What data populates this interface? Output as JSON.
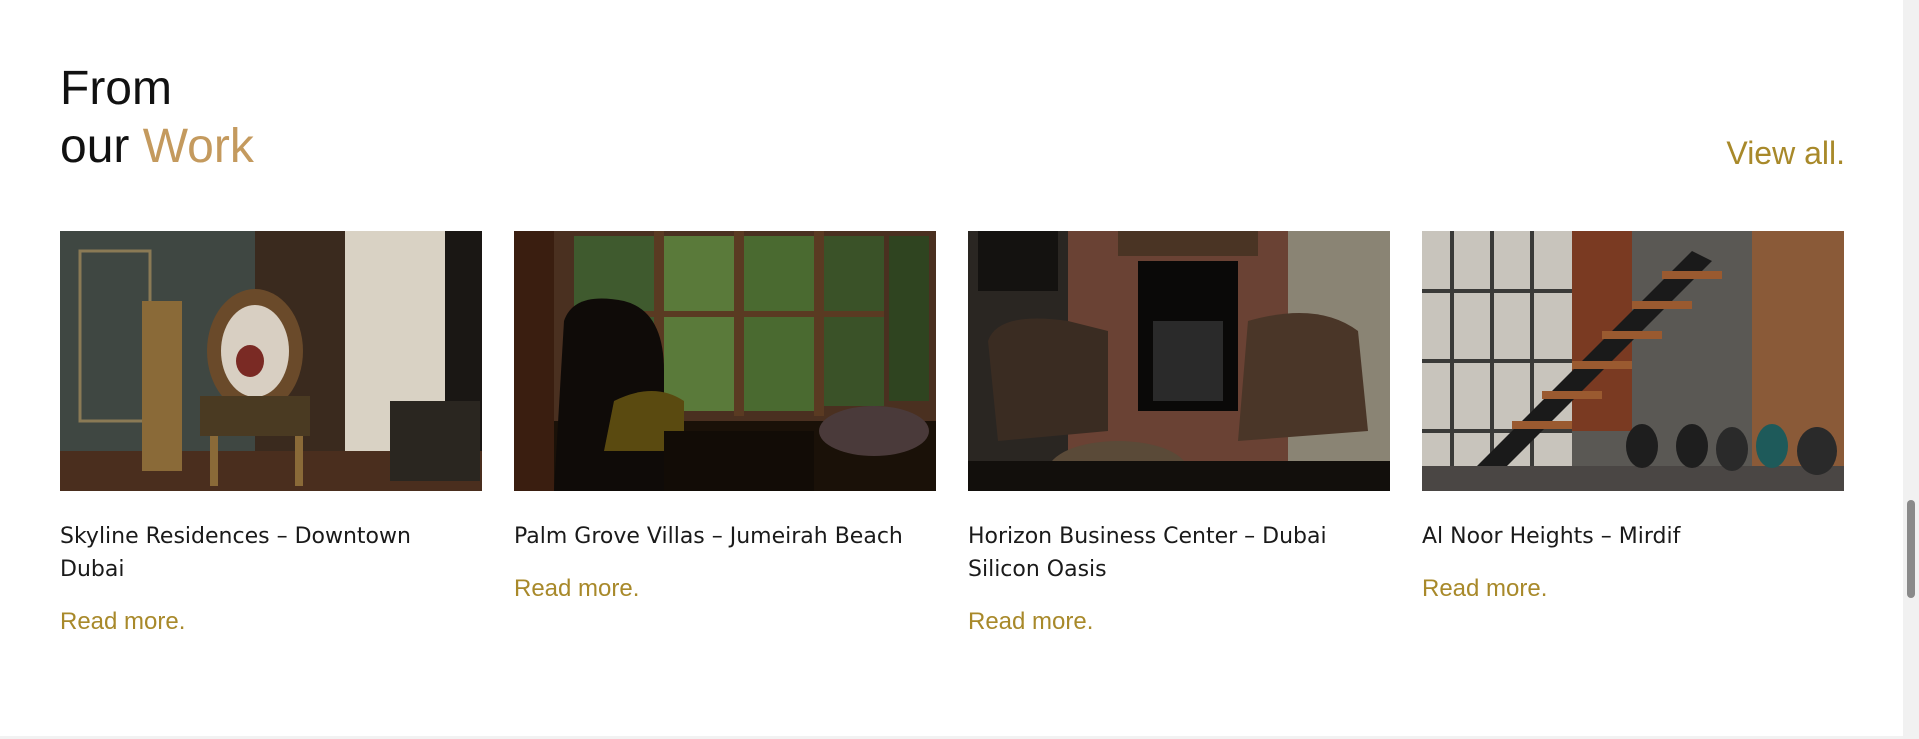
{
  "section": {
    "heading_line1": "From",
    "heading_line2_plain": "our",
    "heading_line2_accent": "Work",
    "view_all": "View all."
  },
  "cards": [
    {
      "title": "Skyline Residences – Downtown Dubai",
      "read_more": "Read more."
    },
    {
      "title": "Palm Grove Villas – Jumeirah Beach",
      "read_more": "Read more."
    },
    {
      "title": "Horizon Business Center – Dubai Silicon Oasis",
      "read_more": "Read more."
    },
    {
      "title": "Al Noor Heights – Mirdif",
      "read_more": "Read more."
    }
  ],
  "colors": {
    "accent": "#c49a5e",
    "link": "#a8892a",
    "text": "#1a1a1a"
  }
}
